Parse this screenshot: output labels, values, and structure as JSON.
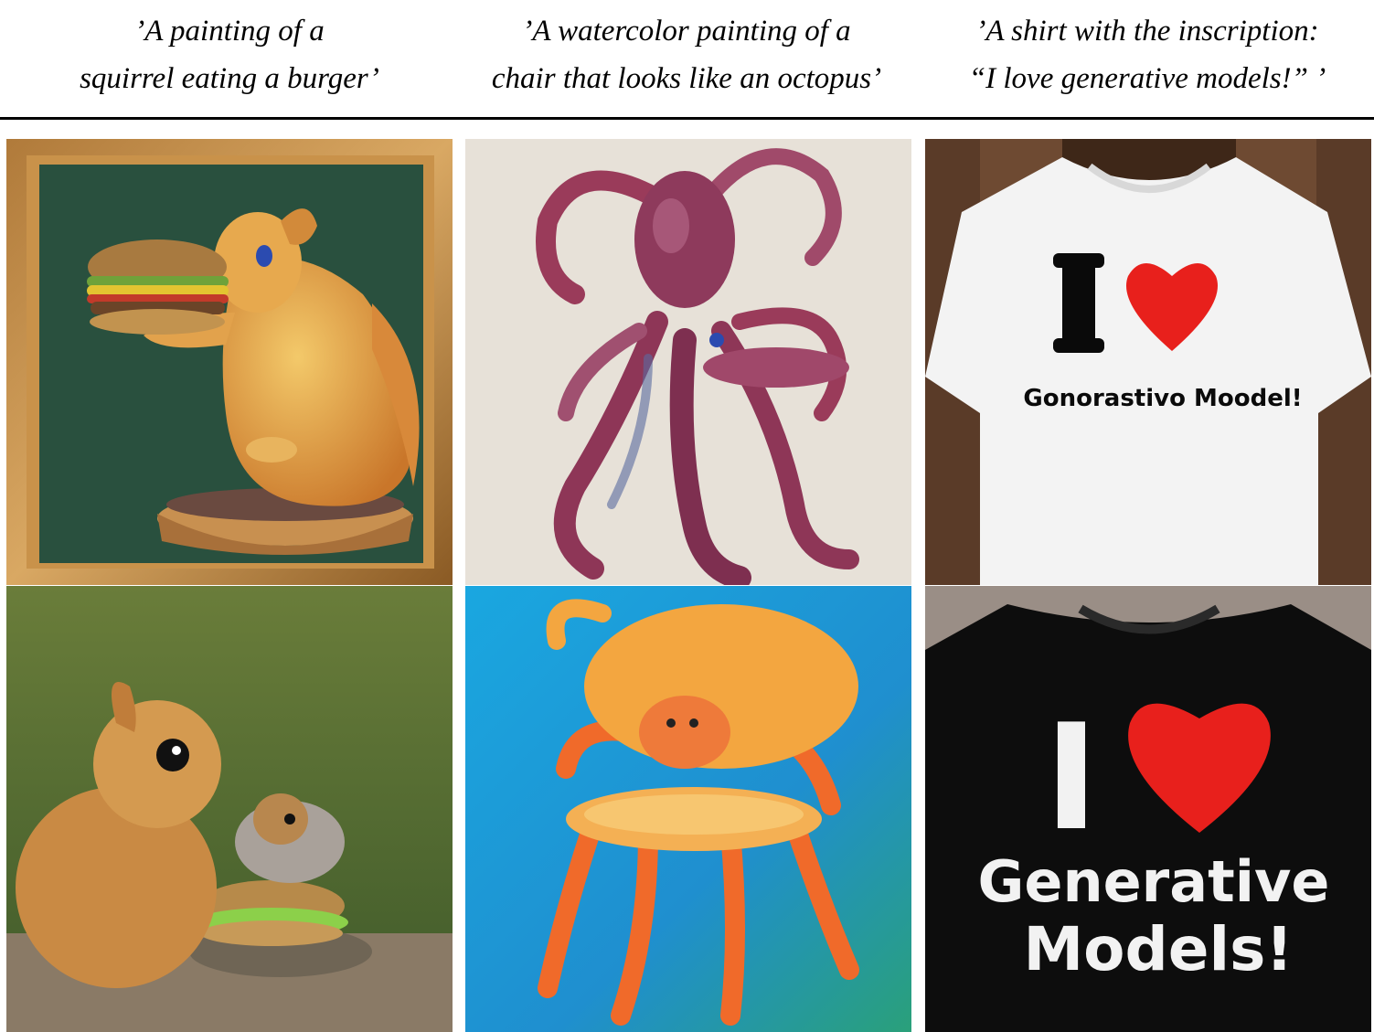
{
  "columns": [
    {
      "caption_line1": "’A painting of a",
      "caption_line2": "squirrel eating a burger’"
    },
    {
      "caption_line1": "’A watercolor painting of a",
      "caption_line2": "chair that looks like an octopus’"
    },
    {
      "caption_line1": "’A shirt with the inscription:",
      "caption_line2": "“I love generative models!” ’"
    }
  ],
  "images": {
    "shirt_white": {
      "line1": "I",
      "line2": "Gonorastivo Moodel!"
    },
    "shirt_black": {
      "line1": "I",
      "line2": "Generative",
      "line3": "Models!"
    }
  },
  "colors": {
    "rule": "#000000",
    "heart": "#e8201c"
  }
}
